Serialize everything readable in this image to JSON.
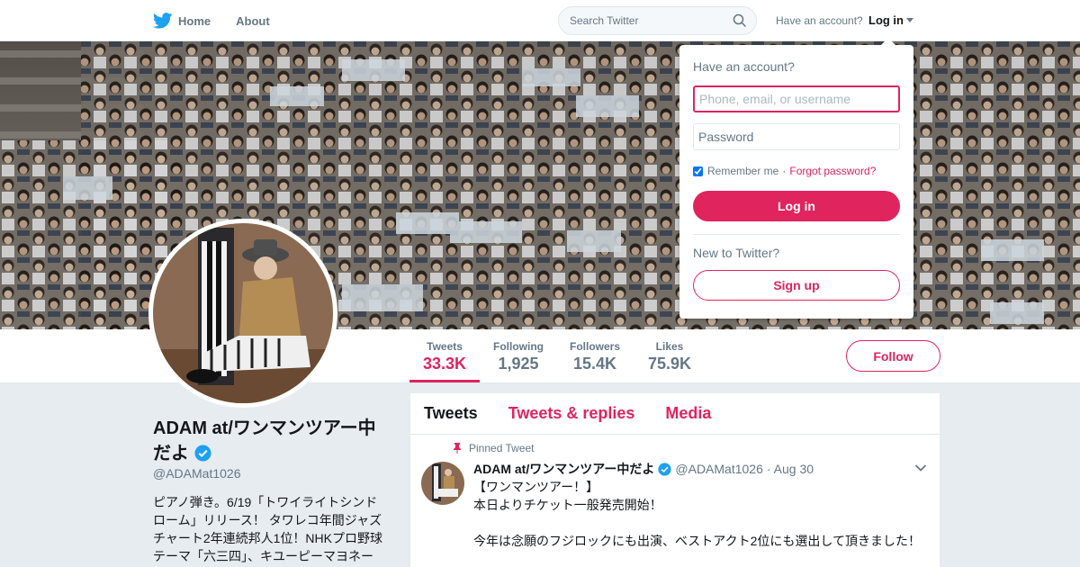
{
  "nav": {
    "home_label": "Home",
    "about_label": "About",
    "search_placeholder": "Search Twitter",
    "have_account": "Have an account?",
    "login_label": "Log in"
  },
  "profile": {
    "name": "ADAM at/ワンマンツアー中だよ",
    "handle": "@ADAMat1026",
    "bio": "ピアノ弾き。6/19「トワイライトシンドローム」リリース！ タワレコ年間ジャズチャート2年連続邦人1位！NHKプロ野球テーマ「六三四」、キユーピーマヨネー",
    "follow_label": "Follow"
  },
  "stats": [
    {
      "label": "Tweets",
      "value": "33.3K"
    },
    {
      "label": "Following",
      "value": "1,925"
    },
    {
      "label": "Followers",
      "value": "15.4K"
    },
    {
      "label": "Likes",
      "value": "75.9K"
    }
  ],
  "timeline": {
    "tabs": [
      "Tweets",
      "Tweets & replies",
      "Media"
    ],
    "pinned_label": "Pinned Tweet",
    "tweet": {
      "name": "ADAM at/ワンマンツアー中だよ",
      "handle": "@ADAMat1026",
      "date": "· Aug 30",
      "lines": [
        "【ワンマンツアー！】",
        "本日よりチケット一般発売開始！",
        "",
        "今年は念願のフジロックにも出演、ベストアクト2位にも選出して頂きました！"
      ]
    }
  },
  "login_dropdown": {
    "question": "Have an account?",
    "username_placeholder": "Phone, email, or username",
    "password_placeholder": "Password",
    "remember_label": "Remember me",
    "separator": "·",
    "forgot_label": "Forgot password?",
    "login_button": "Log in",
    "new_label": "New to Twitter?",
    "signup_button": "Sign up"
  },
  "colors": {
    "accent": "#e0245e",
    "twitter_blue": "#1da1f2",
    "muted_text": "#657786",
    "background": "#e6ecf0"
  },
  "icons": [
    "twitter-bird-icon",
    "search-icon",
    "caret-down-icon",
    "verified-icon",
    "pin-icon",
    "chevron-down-icon"
  ]
}
